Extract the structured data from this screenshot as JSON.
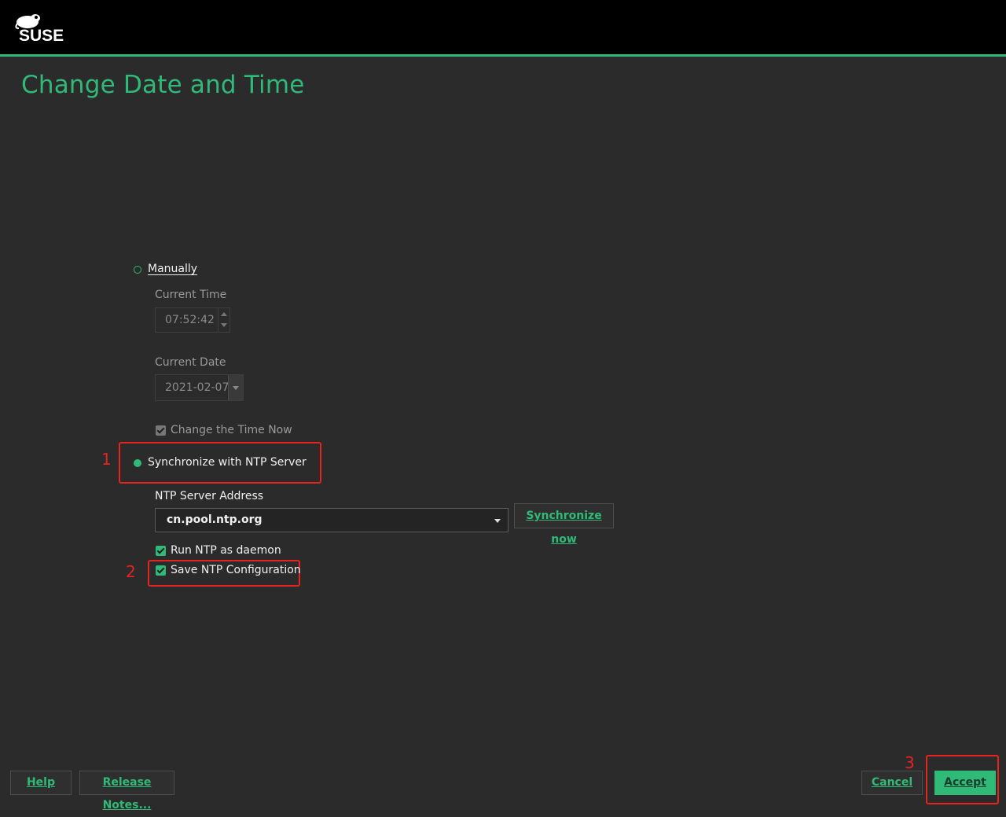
{
  "header": {
    "logo_text": "SUSE"
  },
  "page": {
    "title": "Change Date and Time"
  },
  "manual": {
    "radio_label": "Manually",
    "current_time_label": "Current Time",
    "current_time_value": "07:52:42",
    "current_date_label": "Current Date",
    "current_date_value": "2021-02-07",
    "change_time_now_label": "Change the Time Now"
  },
  "ntp": {
    "radio_label": "Synchronize with NTP Server",
    "server_address_label": "NTP Server Address",
    "server_address_value": "cn.pool.ntp.org",
    "sync_now_label": "Synchronize now",
    "run_daemon_label": "Run NTP as daemon",
    "save_config_label": "Save NTP Configuration"
  },
  "footer": {
    "help_label": "Help",
    "release_notes_label": "Release Notes...",
    "cancel_label": "Cancel",
    "accept_label": "Accept"
  },
  "annotations": {
    "one": "1",
    "two": "2",
    "three": "3"
  },
  "colors": {
    "accent": "#30ba78",
    "annotation": "#e5231f",
    "background": "#2b2b2b"
  },
  "state": {
    "selected_mode": "ntp",
    "change_time_now_checked": true,
    "run_daemon_checked": true,
    "save_config_checked": true
  }
}
